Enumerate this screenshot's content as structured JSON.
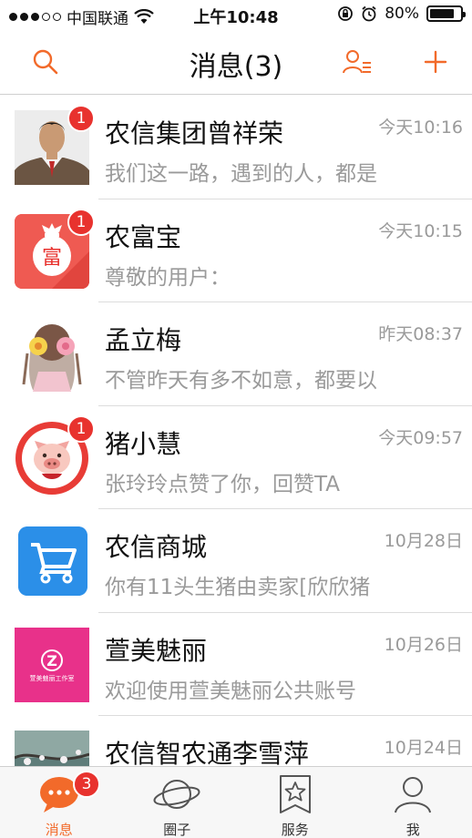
{
  "status_bar": {
    "carrier": "中国联通",
    "time": "上午10:48",
    "battery": "80%",
    "battery_level": 0.8
  },
  "nav": {
    "title": "消息(3)",
    "accent_color": "#f26a2a"
  },
  "messages": [
    {
      "name": "农信集团曾祥荣",
      "time": "今天10:16",
      "preview": "我们这一路，遇到的人，都是",
      "badge": "1",
      "avatar_icon": "person-photo"
    },
    {
      "name": "农富宝",
      "time": "今天10:15",
      "preview": "尊敬的用户：",
      "badge": "1",
      "avatar_icon": "money-bag-icon",
      "avatar_text": "富"
    },
    {
      "name": "孟立梅",
      "time": "昨天08:37",
      "preview": "不管昨天有多不如意，都要以",
      "badge": "",
      "avatar_icon": "girl-with-flowers-illustration"
    },
    {
      "name": "猪小慧",
      "time": "今天09:57",
      "preview": "张玲玲点赞了你，回赞TA",
      "badge": "1",
      "avatar_icon": "pig-mascot-icon"
    },
    {
      "name": "农信商城",
      "time": "10月28日",
      "preview": "你有11头生猪由卖家[欣欣猪",
      "badge": "",
      "avatar_icon": "shopping-cart-icon"
    },
    {
      "name": "萱美魅丽",
      "time": "10月26日",
      "preview": "欢迎使用萱美魅丽公共账号",
      "badge": "",
      "avatar_icon": "z-logo",
      "avatar_logo_letter": "Z",
      "avatar_logo_text": "萱美魅丽工作室"
    },
    {
      "name": "农信智农通李雪萍",
      "time": "10月24日",
      "preview": "",
      "badge": "",
      "avatar_icon": "blossom-photo"
    }
  ],
  "tabs": [
    {
      "label": "消息",
      "icon": "chat-bubble-icon",
      "badge": "3",
      "active": true
    },
    {
      "label": "圈子",
      "icon": "planet-icon",
      "badge": "",
      "active": false
    },
    {
      "label": "服务",
      "icon": "star-bookmark-icon",
      "badge": "",
      "active": false
    },
    {
      "label": "我",
      "icon": "person-icon",
      "badge": "",
      "active": false
    }
  ]
}
